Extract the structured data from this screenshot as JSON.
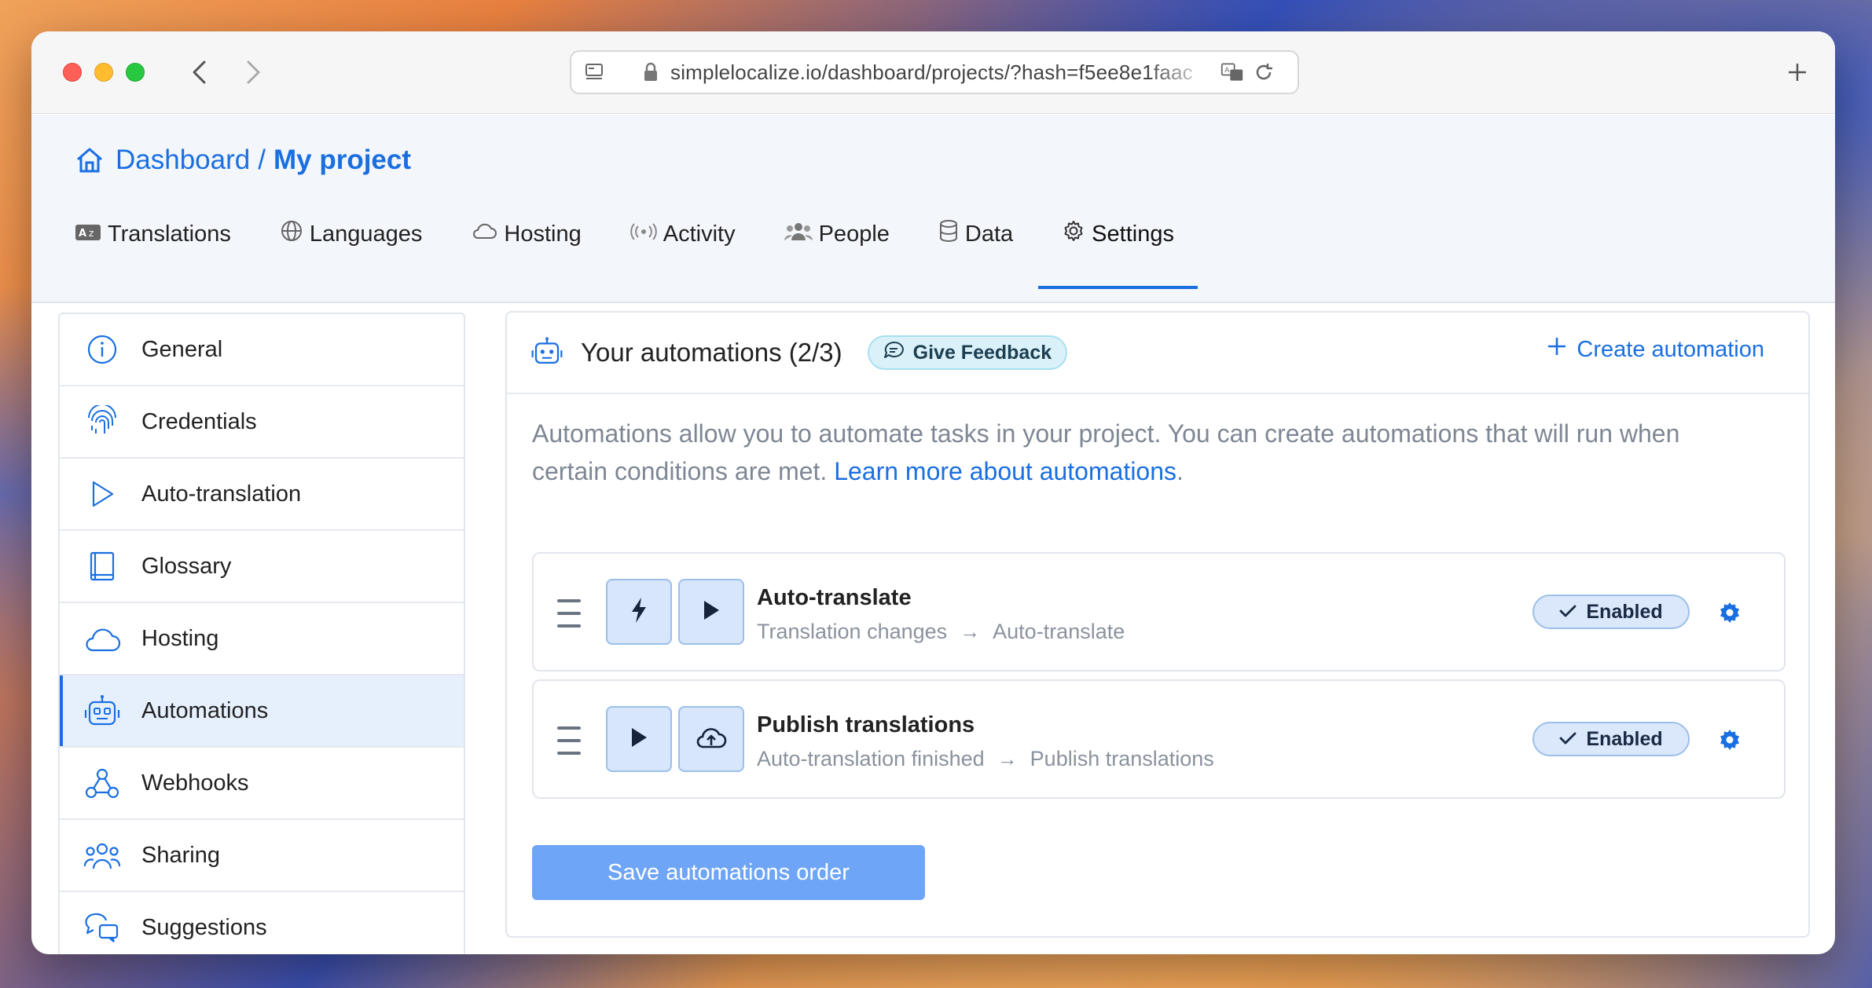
{
  "browser": {
    "url": "simplelocalize.io/dashboard/projects/?hash=f5ee8e1faac"
  },
  "breadcrumb": {
    "root": "Dashboard",
    "separator": "/",
    "project": "My project"
  },
  "tabs": [
    {
      "label": "Translations",
      "icon": "translate-icon"
    },
    {
      "label": "Languages",
      "icon": "globe-icon"
    },
    {
      "label": "Hosting",
      "icon": "cloud-icon"
    },
    {
      "label": "Activity",
      "icon": "broadcast-icon"
    },
    {
      "label": "People",
      "icon": "people-icon"
    },
    {
      "label": "Data",
      "icon": "database-icon"
    },
    {
      "label": "Settings",
      "icon": "gear-icon",
      "active": true
    }
  ],
  "sidebar": {
    "items": [
      {
        "label": "General",
        "icon": "info-icon"
      },
      {
        "label": "Credentials",
        "icon": "fingerprint-icon"
      },
      {
        "label": "Auto-translation",
        "icon": "play-icon"
      },
      {
        "label": "Glossary",
        "icon": "book-icon"
      },
      {
        "label": "Hosting",
        "icon": "cloud-icon"
      },
      {
        "label": "Automations",
        "icon": "robot-icon",
        "active": true
      },
      {
        "label": "Webhooks",
        "icon": "webhook-icon"
      },
      {
        "label": "Sharing",
        "icon": "people-icon"
      },
      {
        "label": "Suggestions",
        "icon": "chat-icon"
      }
    ]
  },
  "automations": {
    "title": "Your automations (2/3)",
    "feedback_label": "Give Feedback",
    "create_label": "Create automation",
    "description": "Automations allow you to automate tasks in your project. You can create automations that will run when certain conditions are met.",
    "learn_more": "Learn more about automations",
    "learn_more_suffix": ".",
    "items": [
      {
        "name": "Auto-translate",
        "trigger": "Translation changes",
        "action": "Auto-translate",
        "status": "Enabled",
        "trigger_icon": "lightning-icon",
        "action_icon": "play-icon"
      },
      {
        "name": "Publish translations",
        "trigger": "Auto-translation finished",
        "action": "Publish translations",
        "status": "Enabled",
        "trigger_icon": "play-icon",
        "action_icon": "cloud-upload-icon"
      }
    ],
    "save_label": "Save automations order"
  },
  "colors": {
    "accent": "#1a6fe0",
    "save_button": "#6ea5f6",
    "muted_text": "#7e8794"
  }
}
